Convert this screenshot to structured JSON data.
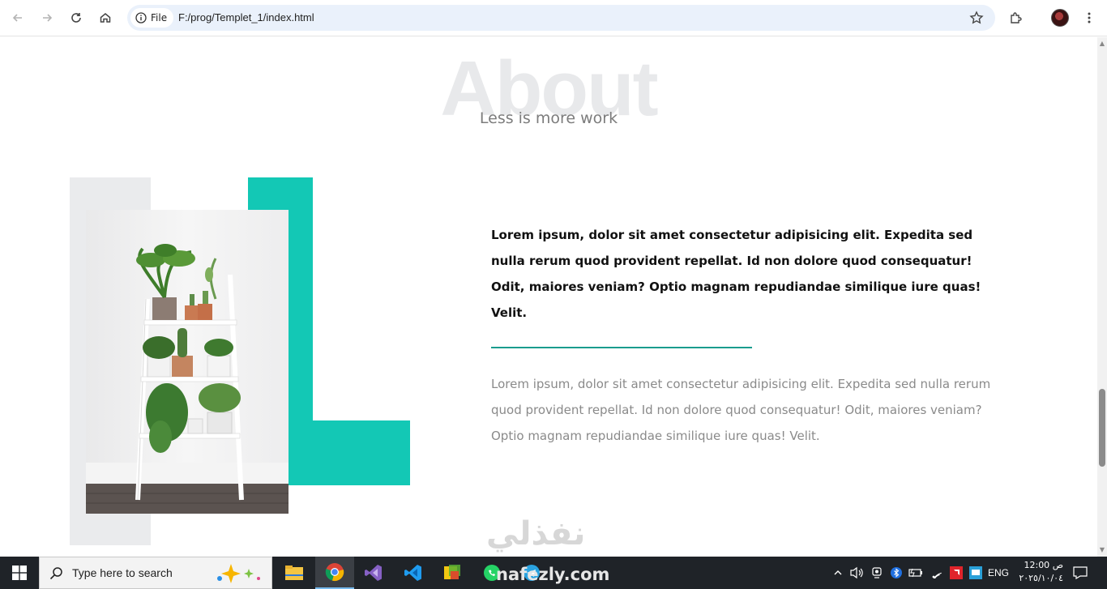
{
  "browser": {
    "site_chip_label": "File",
    "url": "F:/prog/Templet_1/index.html"
  },
  "page": {
    "section_title": "About",
    "section_subtitle": "Less is more work",
    "lead_paragraph": "Lorem ipsum, dolor sit amet consectetur adipisicing elit. Expedita sed nulla rerum quod provident repellat. Id non dolore quod consequatur! Odit, maiores veniam? Optio magnam repudiandae similique iure quas! Velit.",
    "body_paragraph": "Lorem ipsum, dolor sit amet consectetur adipisicing elit. Expedita sed nulla rerum quod provident repellat. Id non dolore quod consequatur! Odit, maiores veniam? Optio magnam repudiandae similique iure quas! Velit.",
    "accent_color": "#13c8b5"
  },
  "watermark": {
    "arabic": "نفذلي",
    "latin": "nafezly.com"
  },
  "taskbar": {
    "search_placeholder": "Type here to search",
    "language": "ENG",
    "time": "12:00 ص",
    "date": "٢٠٢٥/١٠/٠٤",
    "apps": [
      "file-explorer-icon",
      "chrome-icon",
      "visual-studio-icon",
      "vscode-icon",
      "sticky-app-icon",
      "whatsapp-icon",
      "telegram-icon"
    ]
  }
}
